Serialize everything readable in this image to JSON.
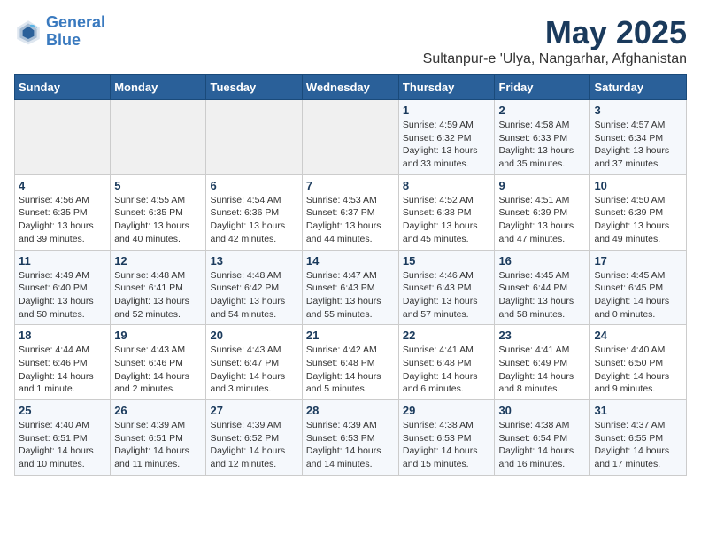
{
  "logo": {
    "line1": "General",
    "line2": "Blue"
  },
  "title": "May 2025",
  "location": "Sultanpur-e 'Ulya, Nangarhar, Afghanistan",
  "days_of_week": [
    "Sunday",
    "Monday",
    "Tuesday",
    "Wednesday",
    "Thursday",
    "Friday",
    "Saturday"
  ],
  "weeks": [
    [
      {
        "day": "",
        "info": ""
      },
      {
        "day": "",
        "info": ""
      },
      {
        "day": "",
        "info": ""
      },
      {
        "day": "",
        "info": ""
      },
      {
        "day": "1",
        "info": "Sunrise: 4:59 AM\nSunset: 6:32 PM\nDaylight: 13 hours\nand 33 minutes."
      },
      {
        "day": "2",
        "info": "Sunrise: 4:58 AM\nSunset: 6:33 PM\nDaylight: 13 hours\nand 35 minutes."
      },
      {
        "day": "3",
        "info": "Sunrise: 4:57 AM\nSunset: 6:34 PM\nDaylight: 13 hours\nand 37 minutes."
      }
    ],
    [
      {
        "day": "4",
        "info": "Sunrise: 4:56 AM\nSunset: 6:35 PM\nDaylight: 13 hours\nand 39 minutes."
      },
      {
        "day": "5",
        "info": "Sunrise: 4:55 AM\nSunset: 6:35 PM\nDaylight: 13 hours\nand 40 minutes."
      },
      {
        "day": "6",
        "info": "Sunrise: 4:54 AM\nSunset: 6:36 PM\nDaylight: 13 hours\nand 42 minutes."
      },
      {
        "day": "7",
        "info": "Sunrise: 4:53 AM\nSunset: 6:37 PM\nDaylight: 13 hours\nand 44 minutes."
      },
      {
        "day": "8",
        "info": "Sunrise: 4:52 AM\nSunset: 6:38 PM\nDaylight: 13 hours\nand 45 minutes."
      },
      {
        "day": "9",
        "info": "Sunrise: 4:51 AM\nSunset: 6:39 PM\nDaylight: 13 hours\nand 47 minutes."
      },
      {
        "day": "10",
        "info": "Sunrise: 4:50 AM\nSunset: 6:39 PM\nDaylight: 13 hours\nand 49 minutes."
      }
    ],
    [
      {
        "day": "11",
        "info": "Sunrise: 4:49 AM\nSunset: 6:40 PM\nDaylight: 13 hours\nand 50 minutes."
      },
      {
        "day": "12",
        "info": "Sunrise: 4:48 AM\nSunset: 6:41 PM\nDaylight: 13 hours\nand 52 minutes."
      },
      {
        "day": "13",
        "info": "Sunrise: 4:48 AM\nSunset: 6:42 PM\nDaylight: 13 hours\nand 54 minutes."
      },
      {
        "day": "14",
        "info": "Sunrise: 4:47 AM\nSunset: 6:43 PM\nDaylight: 13 hours\nand 55 minutes."
      },
      {
        "day": "15",
        "info": "Sunrise: 4:46 AM\nSunset: 6:43 PM\nDaylight: 13 hours\nand 57 minutes."
      },
      {
        "day": "16",
        "info": "Sunrise: 4:45 AM\nSunset: 6:44 PM\nDaylight: 13 hours\nand 58 minutes."
      },
      {
        "day": "17",
        "info": "Sunrise: 4:45 AM\nSunset: 6:45 PM\nDaylight: 14 hours\nand 0 minutes."
      }
    ],
    [
      {
        "day": "18",
        "info": "Sunrise: 4:44 AM\nSunset: 6:46 PM\nDaylight: 14 hours\nand 1 minute."
      },
      {
        "day": "19",
        "info": "Sunrise: 4:43 AM\nSunset: 6:46 PM\nDaylight: 14 hours\nand 2 minutes."
      },
      {
        "day": "20",
        "info": "Sunrise: 4:43 AM\nSunset: 6:47 PM\nDaylight: 14 hours\nand 3 minutes."
      },
      {
        "day": "21",
        "info": "Sunrise: 4:42 AM\nSunset: 6:48 PM\nDaylight: 14 hours\nand 5 minutes."
      },
      {
        "day": "22",
        "info": "Sunrise: 4:41 AM\nSunset: 6:48 PM\nDaylight: 14 hours\nand 6 minutes."
      },
      {
        "day": "23",
        "info": "Sunrise: 4:41 AM\nSunset: 6:49 PM\nDaylight: 14 hours\nand 8 minutes."
      },
      {
        "day": "24",
        "info": "Sunrise: 4:40 AM\nSunset: 6:50 PM\nDaylight: 14 hours\nand 9 minutes."
      }
    ],
    [
      {
        "day": "25",
        "info": "Sunrise: 4:40 AM\nSunset: 6:51 PM\nDaylight: 14 hours\nand 10 minutes."
      },
      {
        "day": "26",
        "info": "Sunrise: 4:39 AM\nSunset: 6:51 PM\nDaylight: 14 hours\nand 11 minutes."
      },
      {
        "day": "27",
        "info": "Sunrise: 4:39 AM\nSunset: 6:52 PM\nDaylight: 14 hours\nand 12 minutes."
      },
      {
        "day": "28",
        "info": "Sunrise: 4:39 AM\nSunset: 6:53 PM\nDaylight: 14 hours\nand 14 minutes."
      },
      {
        "day": "29",
        "info": "Sunrise: 4:38 AM\nSunset: 6:53 PM\nDaylight: 14 hours\nand 15 minutes."
      },
      {
        "day": "30",
        "info": "Sunrise: 4:38 AM\nSunset: 6:54 PM\nDaylight: 14 hours\nand 16 minutes."
      },
      {
        "day": "31",
        "info": "Sunrise: 4:37 AM\nSunset: 6:55 PM\nDaylight: 14 hours\nand 17 minutes."
      }
    ]
  ]
}
